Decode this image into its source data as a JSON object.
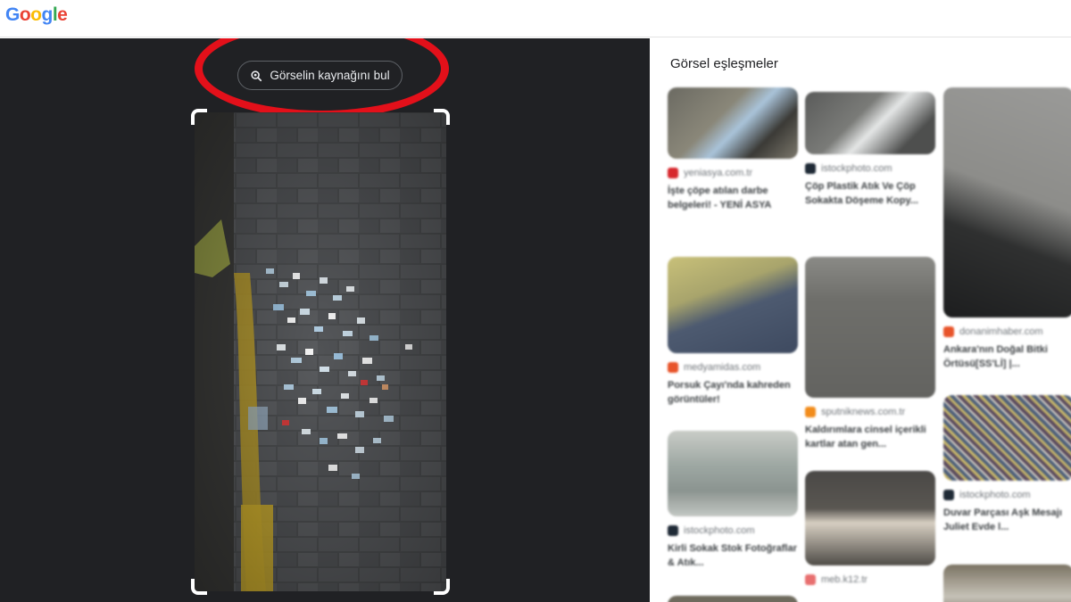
{
  "header": {
    "logo_letters": [
      {
        "ch": "G",
        "color": "#4285F4"
      },
      {
        "ch": "o",
        "color": "#EA4335"
      },
      {
        "ch": "o",
        "color": "#FBBC05"
      },
      {
        "ch": "g",
        "color": "#4285F4"
      },
      {
        "ch": "l",
        "color": "#34A853"
      },
      {
        "ch": "e",
        "color": "#EA4335"
      }
    ]
  },
  "lens": {
    "find_source_label": "Görselin kaynağını bul",
    "find_source_icon": "lens-search-icon",
    "highlight_color": "#e3101a"
  },
  "results": {
    "title": "Görsel eşleşmeler",
    "cards": [
      {
        "source": "yeniasya.com.tr",
        "favicon": "Y",
        "fav_color": "#d7262c",
        "title": "İşte çöpe atılan darbe belgeleri! - YENİ ASYA"
      },
      {
        "source": "istockphoto.com",
        "favicon": "i",
        "fav_color": "#1f2a36",
        "title": "Çöp Plastik Atık Ve Çöp Sokakta Döşeme Kopy..."
      },
      {
        "source": "donanimhaber.com",
        "favicon": "d",
        "fav_color": "#e8542a",
        "title": "Ankara'nın Doğal Bitki Örtüsü[SS'Lİ] |..."
      },
      {
        "source": "medyamidas.com",
        "favicon": "m",
        "fav_color": "#e8542a",
        "title": "Porsuk Çayı'nda kahreden görüntüler!"
      },
      {
        "source": "sputniknews.com.tr",
        "favicon": "s",
        "fav_color": "#f28c1b",
        "title": "Kaldırımlara cinsel içerikli kartlar atan gen..."
      },
      {
        "source": "istockphoto.com",
        "favicon": "i",
        "fav_color": "#1f2a36",
        "title": "Kirli Sokak Stok Fotoğraflar & Atık..."
      },
      {
        "source": "istockphoto.com",
        "favicon": "i",
        "fav_color": "#1f2a36",
        "title": "Duvar Parçası Aşk Mesajı Juliet Evde l..."
      },
      {
        "source": "meb.k12.tr",
        "favicon": "m",
        "fav_color": "#e86f6f",
        "title": ""
      }
    ]
  }
}
